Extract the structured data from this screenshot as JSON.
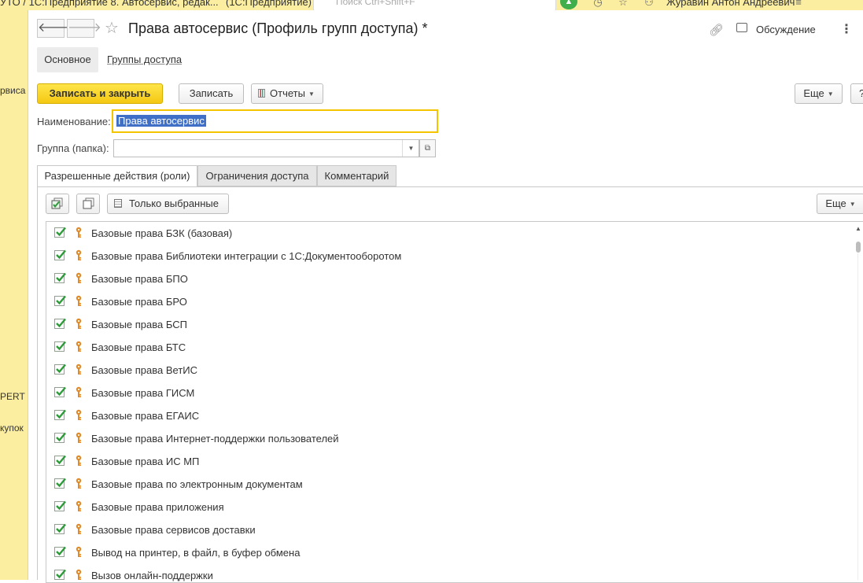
{
  "window": {
    "title_fragment_1": "УТО / 1С:Предприятие 8. Автосервис, редак...",
    "title_fragment_2": "(1С:Предприятие)",
    "search_placeholder": "Поиск Ctrl+Shift+F",
    "user": "Журавин Антон Андреевич"
  },
  "left_panel": {
    "items": [
      "рвиса",
      "PERT",
      "купок"
    ]
  },
  "header": {
    "title": "Права автосервис (Профиль групп доступа) *",
    "discussion_label": "Обсуждение"
  },
  "nav": {
    "main": "Основное",
    "groups": "Группы доступа"
  },
  "commands": {
    "save_close": "Записать и закрыть",
    "save": "Записать",
    "reports": "Отчеты",
    "more": "Еще",
    "help": "?"
  },
  "fields": {
    "name_label": "Наименование:",
    "name_value": "Права автосервис",
    "group_label": "Группа (папка):",
    "group_value": ""
  },
  "tabs": [
    {
      "label": "Разрешенные действия (роли)",
      "active": true
    },
    {
      "label": "Ограничения доступа",
      "active": false
    },
    {
      "label": "Комментарий",
      "active": false
    }
  ],
  "list_toolbar": {
    "only_selected": "Только выбранные",
    "more": "Еще"
  },
  "roles": [
    {
      "label": "Базовые права БЗК (базовая)",
      "checked": true
    },
    {
      "label": "Базовые права Библиотеки интеграции с 1С:Документооборотом",
      "checked": true
    },
    {
      "label": "Базовые права БПО",
      "checked": true
    },
    {
      "label": "Базовые права БРО",
      "checked": true
    },
    {
      "label": "Базовые права БСП",
      "checked": true
    },
    {
      "label": "Базовые права БТС",
      "checked": true
    },
    {
      "label": "Базовые права ВетИС",
      "checked": true
    },
    {
      "label": "Базовые права ГИСМ",
      "checked": true
    },
    {
      "label": "Базовые права ЕГАИС",
      "checked": true
    },
    {
      "label": "Базовые права Интернет-поддержки пользователей",
      "checked": true
    },
    {
      "label": "Базовые права ИС МП",
      "checked": true
    },
    {
      "label": "Базовые права по электронным документам",
      "checked": true
    },
    {
      "label": "Базовые права приложения",
      "checked": true
    },
    {
      "label": "Базовые права сервисов доставки",
      "checked": true
    },
    {
      "label": "Вывод на принтер, в файл, в буфер обмена",
      "checked": true
    },
    {
      "label": "Вызов онлайн-поддержки",
      "checked": true
    }
  ],
  "colors": {
    "accent_yellow": "#f4c812",
    "panel_yellow": "#fbeea0",
    "check_green": "#2e9a3a",
    "key_orange": "#e08a2a",
    "selection_blue": "#3f6fc6"
  }
}
